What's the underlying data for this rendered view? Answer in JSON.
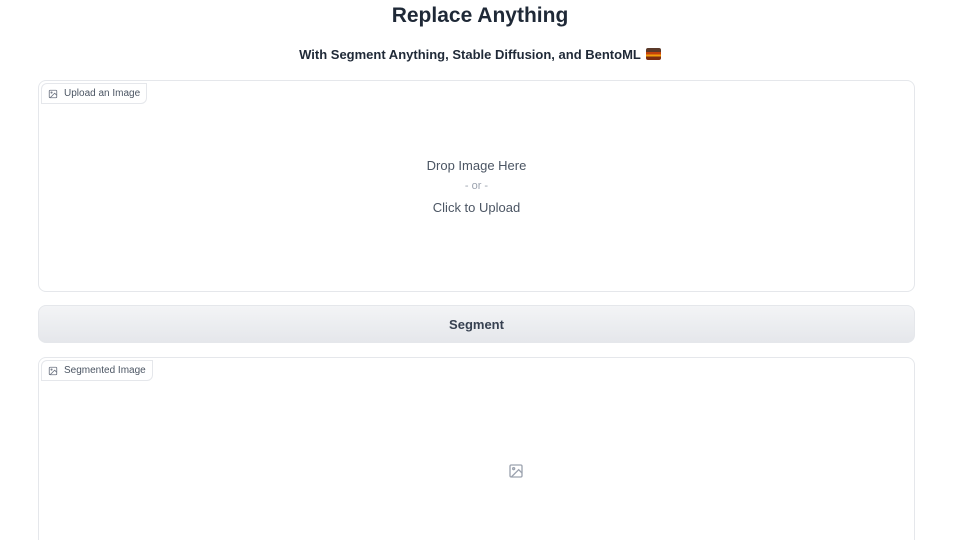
{
  "header": {
    "title": "Replace Anything",
    "subtitle": "With Segment Anything, Stable Diffusion, and BentoML"
  },
  "upload": {
    "label": "Upload an Image",
    "label_icon": "image-icon",
    "drop_text": "Drop Image Here",
    "or_text": "- or -",
    "click_text": "Click to Upload"
  },
  "segment_button": {
    "label": "Segment"
  },
  "segmented": {
    "label": "Segmented Image",
    "label_icon": "image-icon",
    "placeholder_icon": "image-icon"
  },
  "colors": {
    "border": "#e5e7eb",
    "button_bg": "#e5e7eb",
    "text": "#1f2937",
    "muted": "#9ca3af"
  }
}
